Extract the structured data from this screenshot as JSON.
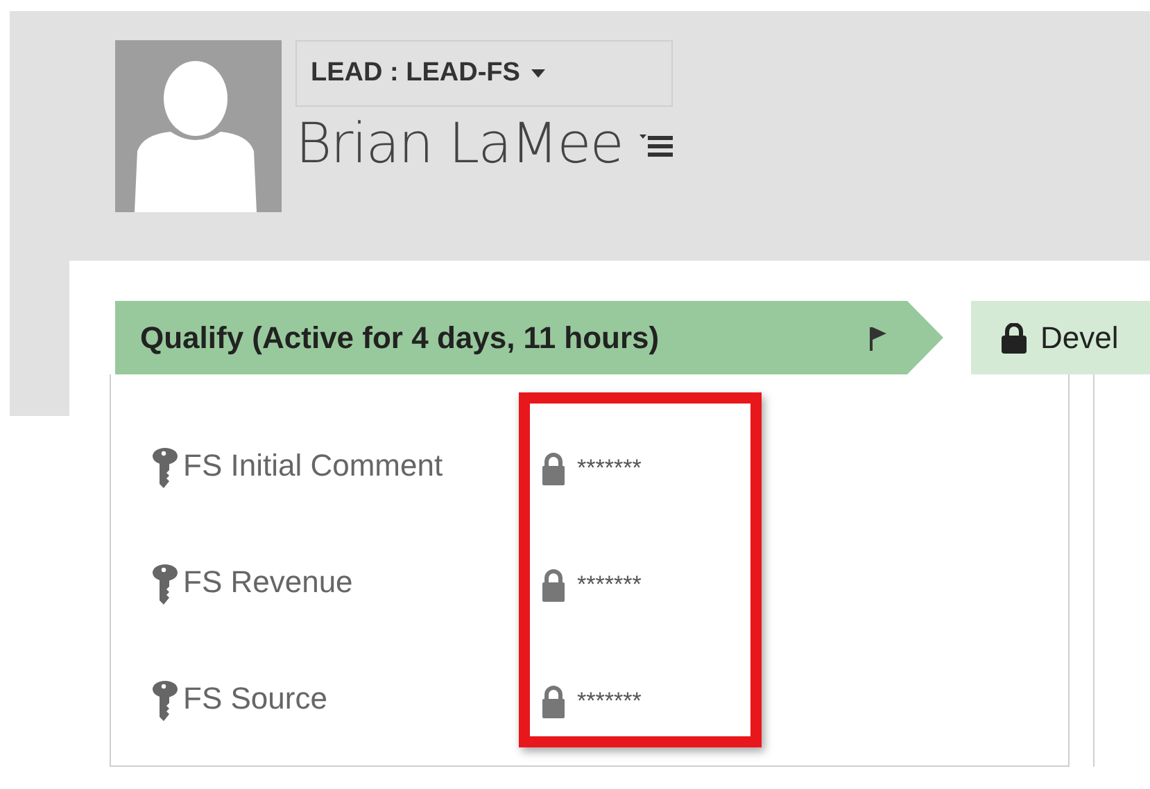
{
  "header": {
    "form_selector": "LEAD : LEAD-FS",
    "record_name": "Brian LaMee"
  },
  "stages": [
    {
      "label": "Qualify (Active for 4 days, 11 hours)",
      "selected": true,
      "locked": false
    },
    {
      "label": "Devel",
      "selected": false,
      "locked": true
    }
  ],
  "fields": [
    {
      "label": "FS Initial Comment",
      "value": "*******",
      "secured": true
    },
    {
      "label": "FS Revenue",
      "value": "*******",
      "secured": true
    },
    {
      "label": "FS Source",
      "value": "*******",
      "secured": true
    }
  ],
  "highlight_values": true
}
